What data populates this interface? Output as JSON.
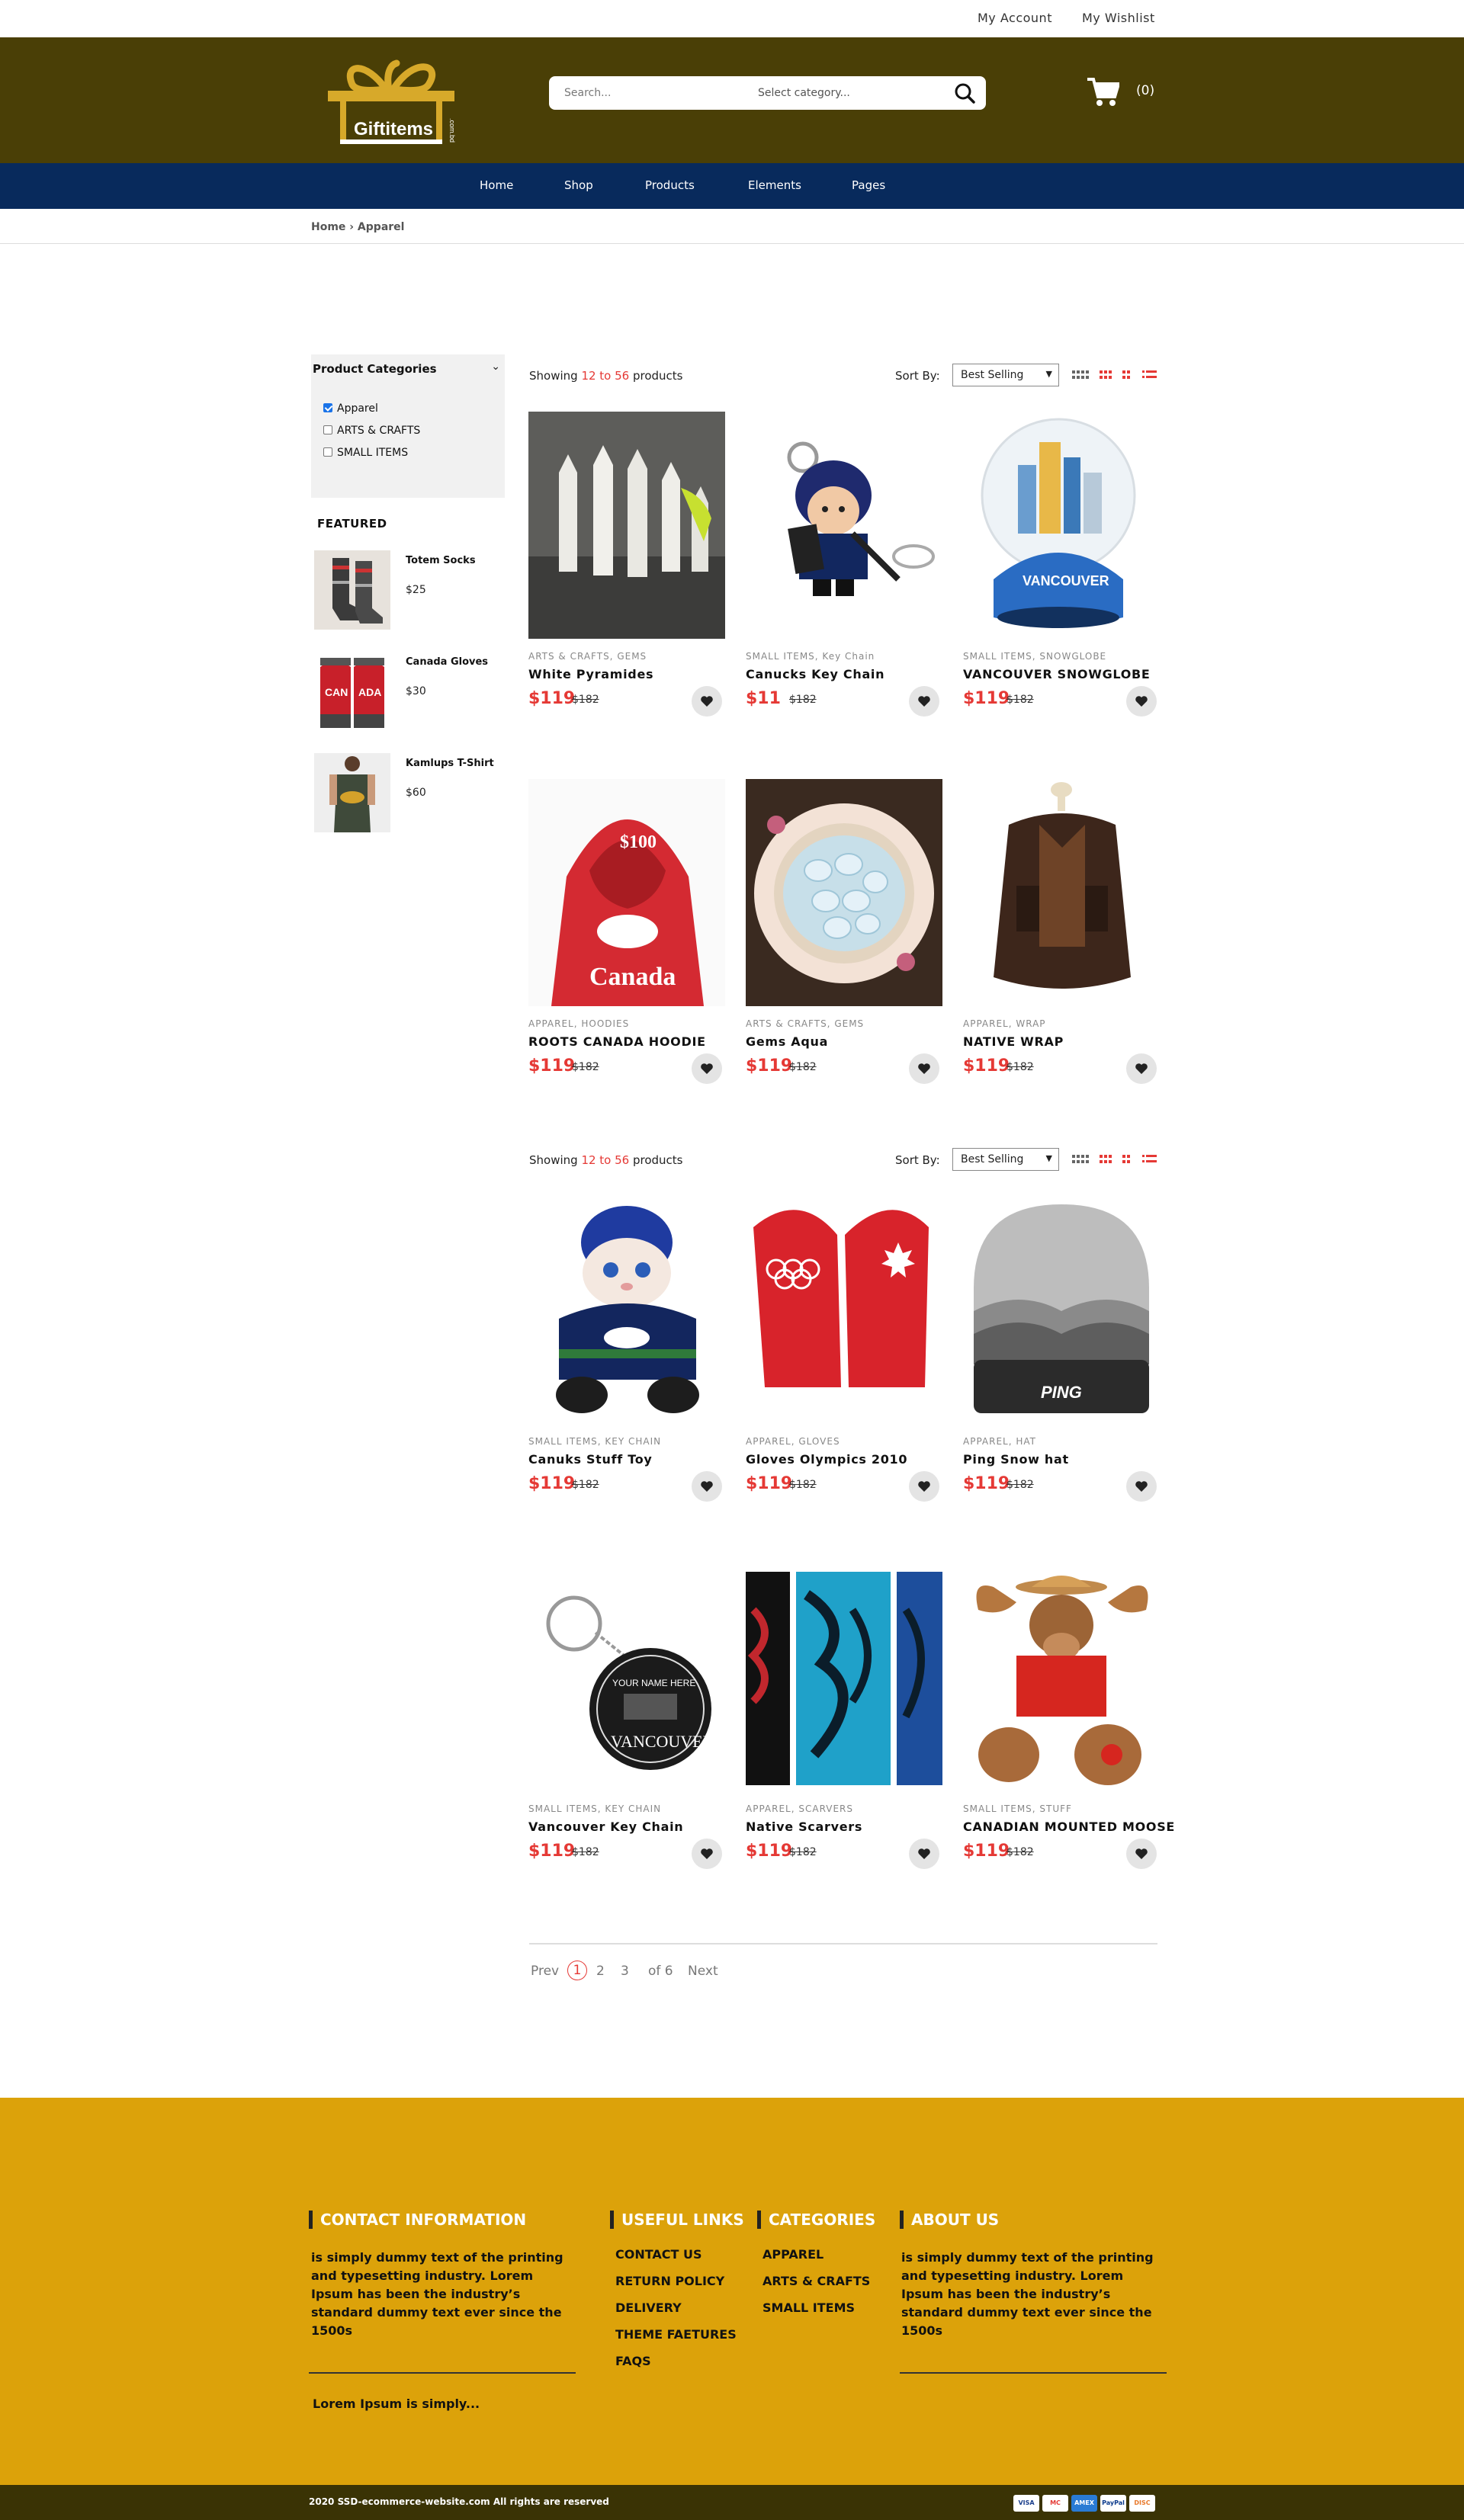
{
  "topbar": {
    "account": "My Account",
    "wishlist": "My Wishlist"
  },
  "header": {
    "logo_text": "Giftitems",
    "logo_suffix": ".com.bd",
    "search_placeholder": "Search...",
    "category_placeholder": "Select category...",
    "cart_count": "(0)"
  },
  "nav": [
    "Home",
    "Shop",
    "Products",
    "Elements",
    "Pages"
  ],
  "breadcrumb": "Home  ›  Apparel",
  "sidebar": {
    "categories_title": "Product Categories",
    "categories": [
      {
        "label": "Apparel",
        "checked": true
      },
      {
        "label": "ARTS & CRAFTS",
        "checked": false
      },
      {
        "label": "SMALL ITEMS",
        "checked": false
      }
    ],
    "featured_title": "FEATURED",
    "featured": [
      {
        "name": "Totem Socks",
        "price": "$25"
      },
      {
        "name": "Canada Gloves",
        "price": "$30"
      },
      {
        "name": "Kamlups T-Shirt",
        "price": "$60"
      }
    ]
  },
  "toolbar": {
    "showing_prefix": "Showing ",
    "showing_range": "12 to 56",
    "showing_suffix": " products",
    "sort_label": "Sort By:",
    "sort_value": "Best Selling"
  },
  "products": [
    {
      "tags": "ARTS & CRAFTS, GEMS",
      "name": "White Pyramides",
      "price": "$119",
      "old": "$182"
    },
    {
      "tags": "SMALL ITEMS, Key Chain",
      "name": "Canucks Key Chain",
      "price": "$11",
      "old": "$182"
    },
    {
      "tags": "SMALL ITEMS, SNOWGLOBE",
      "name": "VANCOUVER SNOWGLOBE",
      "price": "$119",
      "old": "$182"
    },
    {
      "tags": "APPAREL, HOODIES",
      "name": "ROOTS  CANADA HOODIE",
      "price": "$119",
      "old": "$182"
    },
    {
      "tags": "ARTS & CRAFTS, GEMS",
      "name": "Gems Aqua",
      "price": "$119",
      "old": "$182"
    },
    {
      "tags": "APPAREL, WRAP",
      "name": "NATIVE WRAP",
      "price": "$119",
      "old": "$182"
    },
    {
      "tags": "SMALL ITEMS, KEY CHAIN",
      "name": "Canuks Stuff Toy",
      "price": "$119",
      "old": "$182"
    },
    {
      "tags": "APPAREL, GLOVES",
      "name": "Gloves Olympics 2010",
      "price": "$119",
      "old": "$182"
    },
    {
      "tags": "APPAREL, HAT",
      "name": "Ping Snow hat",
      "price": "$119",
      "old": "$182"
    },
    {
      "tags": "SMALL ITEMS, KEY CHAIN",
      "name": "Vancouver Key Chain",
      "price": "$119",
      "old": "$182"
    },
    {
      "tags": "APPAREL, SCARVERS",
      "name": "Native Scarvers",
      "price": "$119",
      "old": "$182"
    },
    {
      "tags": "SMALL ITEMS, STUFF",
      "name": "CANADIAN MOUNTED MOOSE",
      "price": "$119",
      "old": "$182"
    }
  ],
  "pagination": {
    "prev": "Prev",
    "pages": [
      "1",
      "2",
      "3"
    ],
    "of": "of 6",
    "next": "Next"
  },
  "footer": {
    "contact_title": "CONTACT INFORMATION",
    "contact_text": "is simply dummy text of the printing and typesetting industry. Lorem Ipsum has been the industry’s standard dummy text ever since the 1500s",
    "contact_sub": "Lorem Ipsum is simply...",
    "useful_title": "USEFUL LINKS",
    "useful_links": [
      "CONTACT US",
      "RETURN POLICY",
      "DELIVERY",
      "THEME FAETURES",
      "FAQS"
    ],
    "categories_title": "CATEGORIES",
    "categories": [
      "APPAREL",
      "ARTS & CRAFTS",
      "SMALL ITEMS"
    ],
    "about_title": "ABOUT US",
    "about_text": "is simply dummy text of the printing and typesetting industry. Lorem Ipsum has been the industry’s standard dummy text ever since the 1500s",
    "copyright": "2020 SSD-ecommerce-website.com All rights are reserved",
    "payments": [
      "VISA",
      "MC",
      "AMEX",
      "PayPal",
      "DISC"
    ]
  },
  "colors": {
    "brand_dark": "#4a3f06",
    "nav": "#082a5c",
    "accent_red": "#e53935",
    "footer": "#dca20a"
  }
}
